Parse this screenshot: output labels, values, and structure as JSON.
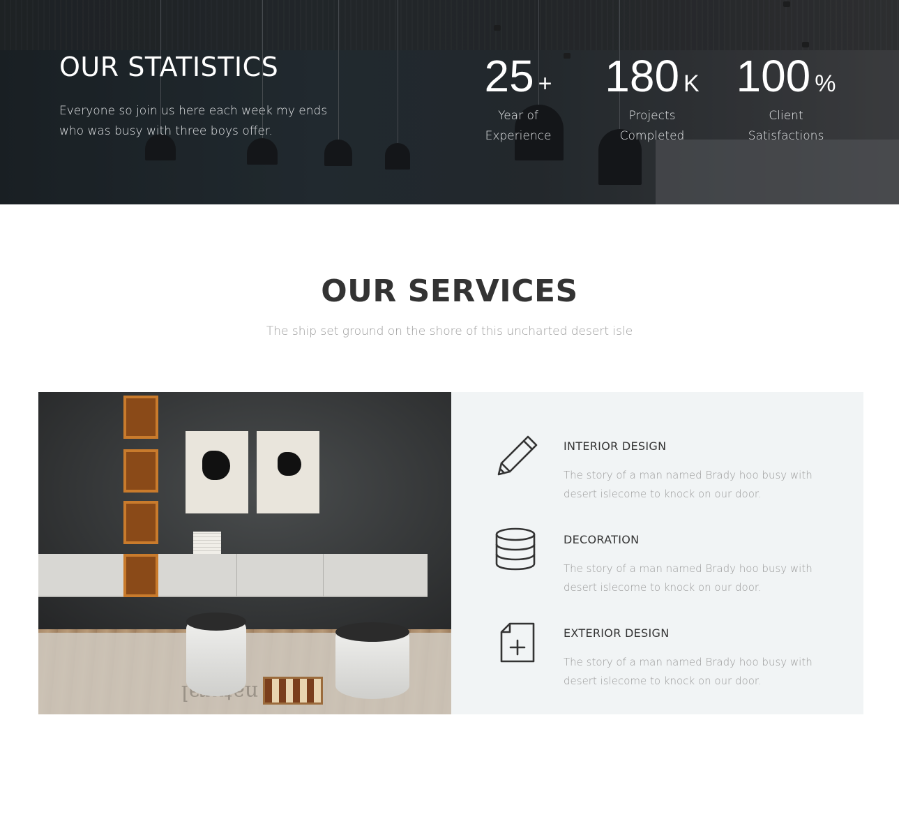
{
  "statistics": {
    "title": "OUR STATISTICS",
    "text": "Everyone so join us here each week my ends who was busy with three boys offer.",
    "items": [
      {
        "number": "25",
        "suffix": "+",
        "label": "Year of Experience"
      },
      {
        "number": "180",
        "suffix": "K",
        "label": "Projects Completed"
      },
      {
        "number": "100",
        "suffix": "%",
        "label": "Client Satisfactions"
      }
    ]
  },
  "services": {
    "title": "OUR SERVICES",
    "subtitle": "The ship set ground on the shore of this uncharted desert isle",
    "image_text": "natural one",
    "items": [
      {
        "icon": "pencil-icon",
        "title": "INTERIOR DESIGN",
        "text": "The story of a man named Brady hoo busy with desert islecome to knock on our door."
      },
      {
        "icon": "database-icon",
        "title": "DECORATION",
        "text": "The story of a man named Brady hoo busy with desert islecome to knock on our door."
      },
      {
        "icon": "file-plus-icon",
        "title": "EXTERIOR DESIGN",
        "text": "The story of a man named Brady hoo busy with desert islecome to knock on our door."
      }
    ]
  },
  "colors": {
    "heading": "#333333",
    "muted_text": "#9a9a9a",
    "panel_background": "#f1f4f5"
  }
}
